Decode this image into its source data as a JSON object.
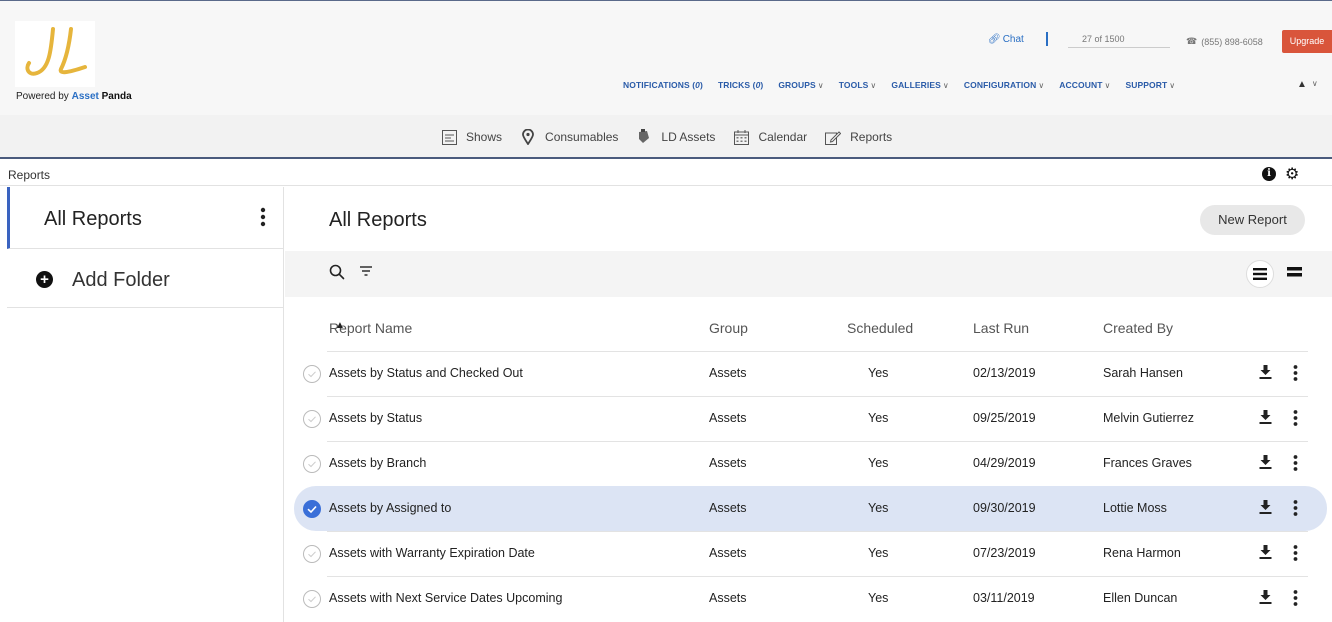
{
  "brand": {
    "logo_text": "JL",
    "powered_prefix": "Powered by",
    "powered_brand": "Asset",
    "powered_brand2": "Panda"
  },
  "utility": {
    "chat": "Chat",
    "usage": "27 of 1500",
    "phone": "(855) 898-6058",
    "upgrade": "Upgrade"
  },
  "main_nav": [
    {
      "label": "NOTIFICATIONS (",
      "count": "0",
      "suffix": ")",
      "caret": false
    },
    {
      "label": "TRICKS (",
      "count": "0",
      "suffix": ")",
      "caret": false
    },
    {
      "label": "GROUPS",
      "count": "",
      "suffix": "",
      "caret": true
    },
    {
      "label": "TOOLS",
      "count": "",
      "suffix": "",
      "caret": true
    },
    {
      "label": "GALLERIES",
      "count": "",
      "suffix": "",
      "caret": true
    },
    {
      "label": "CONFIGURATION",
      "count": "",
      "suffix": "",
      "caret": true
    },
    {
      "label": "ACCOUNT",
      "count": "",
      "suffix": "",
      "caret": true
    },
    {
      "label": "SUPPORT",
      "count": "",
      "suffix": "",
      "caret": true
    }
  ],
  "modules": [
    {
      "label": "Shows",
      "icon": "list-icon"
    },
    {
      "label": "Consumables",
      "icon": "location-pin-icon"
    },
    {
      "label": "LD Assets",
      "icon": "light-icon"
    },
    {
      "label": "Calendar",
      "icon": "calendar-icon"
    },
    {
      "label": "Reports",
      "icon": "edit-icon"
    }
  ],
  "breadcrumb": "Reports",
  "sidebar": {
    "active": "All Reports",
    "add_folder": "Add Folder"
  },
  "main": {
    "title": "All Reports",
    "new_report": "New Report"
  },
  "columns": {
    "name": "Report Name",
    "group": "Group",
    "scheduled": "Scheduled",
    "last_run": "Last Run",
    "created_by": "Created By"
  },
  "reports": [
    {
      "name": "Assets by Status and Checked Out",
      "group": "Assets",
      "scheduled": "Yes",
      "last_run": "02/13/2019",
      "created_by": "Sarah Hansen",
      "selected": false
    },
    {
      "name": "Assets by Status",
      "group": "Assets",
      "scheduled": "Yes",
      "last_run": "09/25/2019",
      "created_by": "Melvin Gutierrez",
      "selected": false
    },
    {
      "name": "Assets by Branch",
      "group": "Assets",
      "scheduled": "Yes",
      "last_run": "04/29/2019",
      "created_by": "Frances Graves",
      "selected": false
    },
    {
      "name": "Assets by Assigned to",
      "group": "Assets",
      "scheduled": "Yes",
      "last_run": "09/30/2019",
      "created_by": "Lottie Moss",
      "selected": true
    },
    {
      "name": "Assets with Warranty Expiration Date",
      "group": "Assets",
      "scheduled": "Yes",
      "last_run": "07/23/2019",
      "created_by": "Rena Harmon",
      "selected": false
    },
    {
      "name": "Assets with Next Service Dates Upcoming",
      "group": "Assets",
      "scheduled": "Yes",
      "last_run": "03/11/2019",
      "created_by": "Ellen Duncan",
      "selected": false
    }
  ],
  "colors": {
    "accent": "#3a6fd8",
    "nav_link": "#2a5ba8",
    "upgrade": "#d9553b",
    "selected_row": "#dce4f4"
  }
}
